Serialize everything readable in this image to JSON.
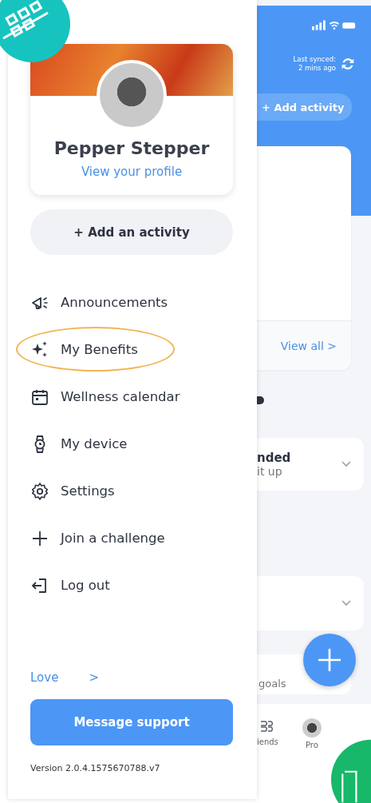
{
  "drawer": {
    "profile": {
      "name": "Pepper Stepper",
      "link": "View your profile"
    },
    "add_button": {
      "icon": "+",
      "label": "Add an activity"
    },
    "menu": [
      {
        "label": "Announcements",
        "kind": "megaphone",
        "highlighted": false
      },
      {
        "label": "My Benefits",
        "kind": "sparkles",
        "highlighted": true
      },
      {
        "label": "Wellness calendar",
        "kind": "calendar",
        "highlighted": false
      },
      {
        "label": "My device",
        "kind": "watch",
        "highlighted": false
      },
      {
        "label": "Settings",
        "kind": "gear",
        "highlighted": false
      },
      {
        "label": "Join a challenge",
        "kind": "plus",
        "highlighted": false
      },
      {
        "label": "Log out",
        "kind": "logout",
        "highlighted": false
      }
    ],
    "love_link": {
      "label": "Love",
      "arrow": ">"
    },
    "support_button": "Message support",
    "version": "Version 2.0.4.1575670788.v7"
  },
  "background": {
    "sync": "Last synced:\n2 mins ago",
    "add_activity": "+ Add activity",
    "view_all": "View all >",
    "card_title": "nded",
    "card_subtitle": "it up",
    "goals": "goals",
    "nav": [
      {
        "label": "iends",
        "kind": "friends"
      },
      {
        "label": "Pro",
        "kind": "profile"
      }
    ]
  }
}
